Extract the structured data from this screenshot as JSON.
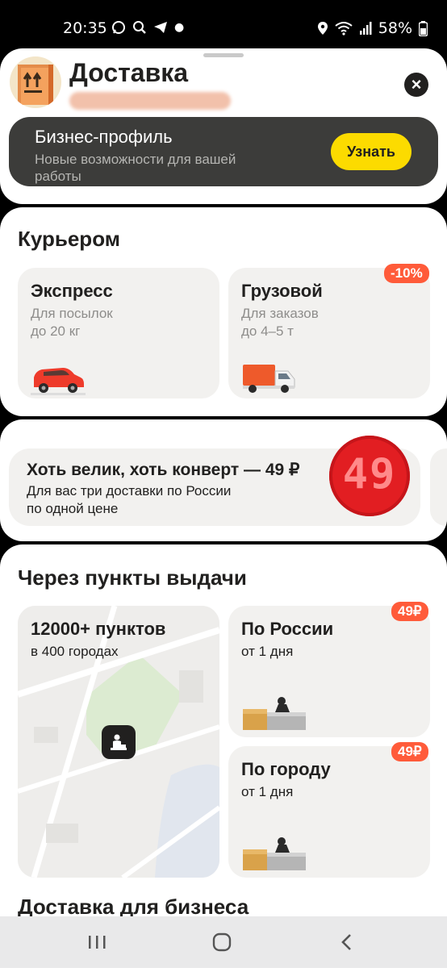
{
  "status_bar": {
    "time": "20:35",
    "battery": "58%"
  },
  "header": {
    "title": "Доставка",
    "banner": {
      "title": "Бизнес-профиль",
      "subtitle": "Новые возможности для вашей работы",
      "button_label": "Узнать"
    }
  },
  "courier": {
    "title": "Курьером",
    "tiles": [
      {
        "title": "Экспресс",
        "line1": "Для посылок",
        "line2": "до 20 кг"
      },
      {
        "title": "Грузовой",
        "line1": "Для заказов",
        "line2": "до 4–5 т",
        "badge": "-10%"
      }
    ]
  },
  "promo": {
    "title": "Хоть велик, хоть конверт — 49 ₽",
    "line1": "Для вас три доставки по России",
    "line2": "по одной цене",
    "number": "49"
  },
  "pickup": {
    "title": "Через пункты выдачи",
    "map_tile": {
      "title": "12000+ пунктов",
      "subtitle": "в 400 городах"
    },
    "russia": {
      "title": "По России",
      "subtitle": "от 1 дня",
      "badge": "49₽"
    },
    "city": {
      "title": "По городу",
      "subtitle": "от 1 дня",
      "badge": "49₽"
    }
  },
  "business": {
    "title": "Доставка для бизнеса"
  },
  "colors": {
    "accent_yellow": "#fcdb00",
    "badge_red": "#ff5b3a",
    "promo_red": "#e21e22"
  },
  "icons": [
    "whatsapp-icon",
    "search-icon",
    "telegram-icon",
    "location-icon",
    "wifi-icon",
    "signal-icon",
    "battery-icon",
    "close-icon",
    "recents-icon",
    "home-icon",
    "back-icon"
  ]
}
